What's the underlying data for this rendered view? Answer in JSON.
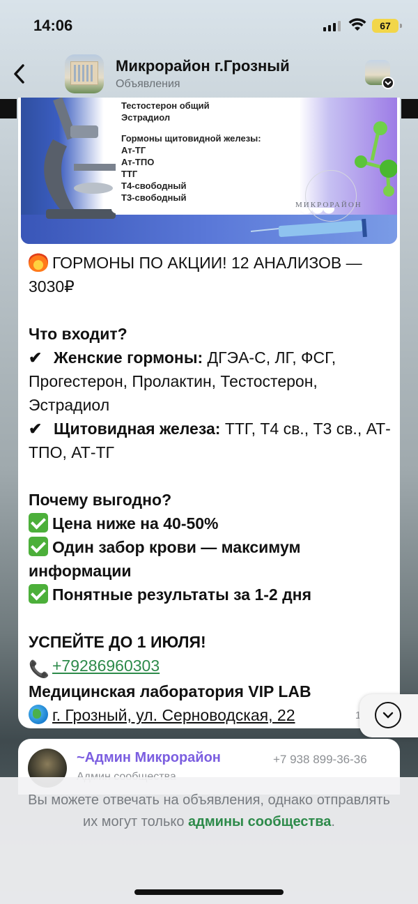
{
  "status_bar": {
    "time": "14:06",
    "battery": "67"
  },
  "header": {
    "title": "Микрорайон г.Грозный",
    "subtitle": "Объявления",
    "back_icon": "chevron-left-icon",
    "channel_avatar_icon": "building-avatar"
  },
  "media": {
    "lines_group1": [
      "Тестостерон общий",
      "Эстрадиол"
    ],
    "lines_group2": [
      "Гормоны щитовидной железы:",
      "Ат-ТГ",
      "Ат-ТПО",
      "ТТГ",
      "Т4-свободный",
      "Т3-свободный"
    ],
    "logo_text": "МИКРОРАЙОН"
  },
  "post": {
    "headline": "ГОРМОНЫ ПО АКЦИИ! 12 АНАЛИЗОВ — 3030₽",
    "what_title": "Что входит?",
    "female_label": "Женские гормоны:",
    "female_text": " ДГЭА-С, ЛГ, ФСГ, Прогестерон, Пролактин, Тестостерон, Эстрадиол",
    "thyroid_label": "Щитовидная железа:",
    "thyroid_text": " ТТГ, Т4 св., Т3 св., АТ-ТПО, АТ-ТГ",
    "why_title": "Почему выгодно?",
    "benefits": [
      "Цена ниже на 40-50%",
      "Один забор крови — максимум информации",
      "Понятные результаты за 1-2 дня"
    ],
    "deadline": "УСПЕЙТЕ ДО 1 ИЮЛЯ!",
    "phone": "+79286960303",
    "lab_name": "Медицинская лаборатория VIP LAB",
    "address": "г. Грозный, ул. Серноводская, 22",
    "time_partial": "1"
  },
  "next_message": {
    "sender": "~Админ Микрорайон",
    "phone": "+7 938 899-36-36",
    "role": "Админ сообщества"
  },
  "notice": {
    "text_before": "Вы можете отвечать на объявления, однако отправлять их могут только ",
    "highlight": "админы сообщества",
    "text_after": "."
  },
  "colors": {
    "link_green": "#2d8a4a",
    "admin_purple": "#7b5ee0",
    "check_green": "#4caf3a"
  }
}
